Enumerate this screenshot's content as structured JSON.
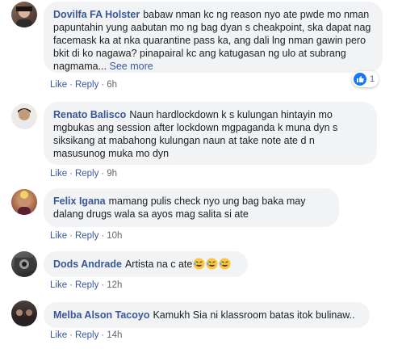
{
  "colors": {
    "link": "#385898",
    "bubble": "#f2f3f5",
    "meta": "#606770",
    "like_blue": "#1877f2"
  },
  "comments": [
    {
      "author": "Dovilfa FA Holster",
      "text": "babaw nman kc ng reason nyo ate pwde mo nman papuntahin yung aabutan mo ng bag dyan s cheakpoint, ska dapat nag facemask ka at nka quarantine pass ka, ang dali lng nman gawin pero bkit di ko nagawa? pinapairal kc ang katugasan ng ulo at subrang nagmama...",
      "see_more": "See more",
      "like": "Like",
      "reply": "Reply",
      "time": "6h",
      "reaction_icon": "like-icon",
      "reaction_count": "1"
    },
    {
      "author": "Renato Balisco",
      "text": "Naun hardlockdown k s kulungan hintayin mo mgbukas ang session after lockdown mgpaganda k muna dyn s siksikang at mabahong kulungan naun at take note ate d n masusunog muka mo dyn",
      "like": "Like",
      "reply": "Reply",
      "time": "9h"
    },
    {
      "author": "Felix Igana",
      "text": "mamang pulis check nyo ung bag baka may dalang drugs wala sa ayos mag salita si ate",
      "like": "Like",
      "reply": "Reply",
      "time": "10h"
    },
    {
      "author": "Dods Andrade",
      "text": "Artista na c ate",
      "emojis": [
        "rofl-emoji",
        "rofl-emoji",
        "rofl-emoji"
      ],
      "like": "Like",
      "reply": "Reply",
      "time": "12h"
    },
    {
      "author": "Melba Alson Tacoyo",
      "text": "Kamukh Sia ni klassroom batas itok bulinaw..",
      "like": "Like",
      "reply": "Reply",
      "time": "14h"
    }
  ]
}
